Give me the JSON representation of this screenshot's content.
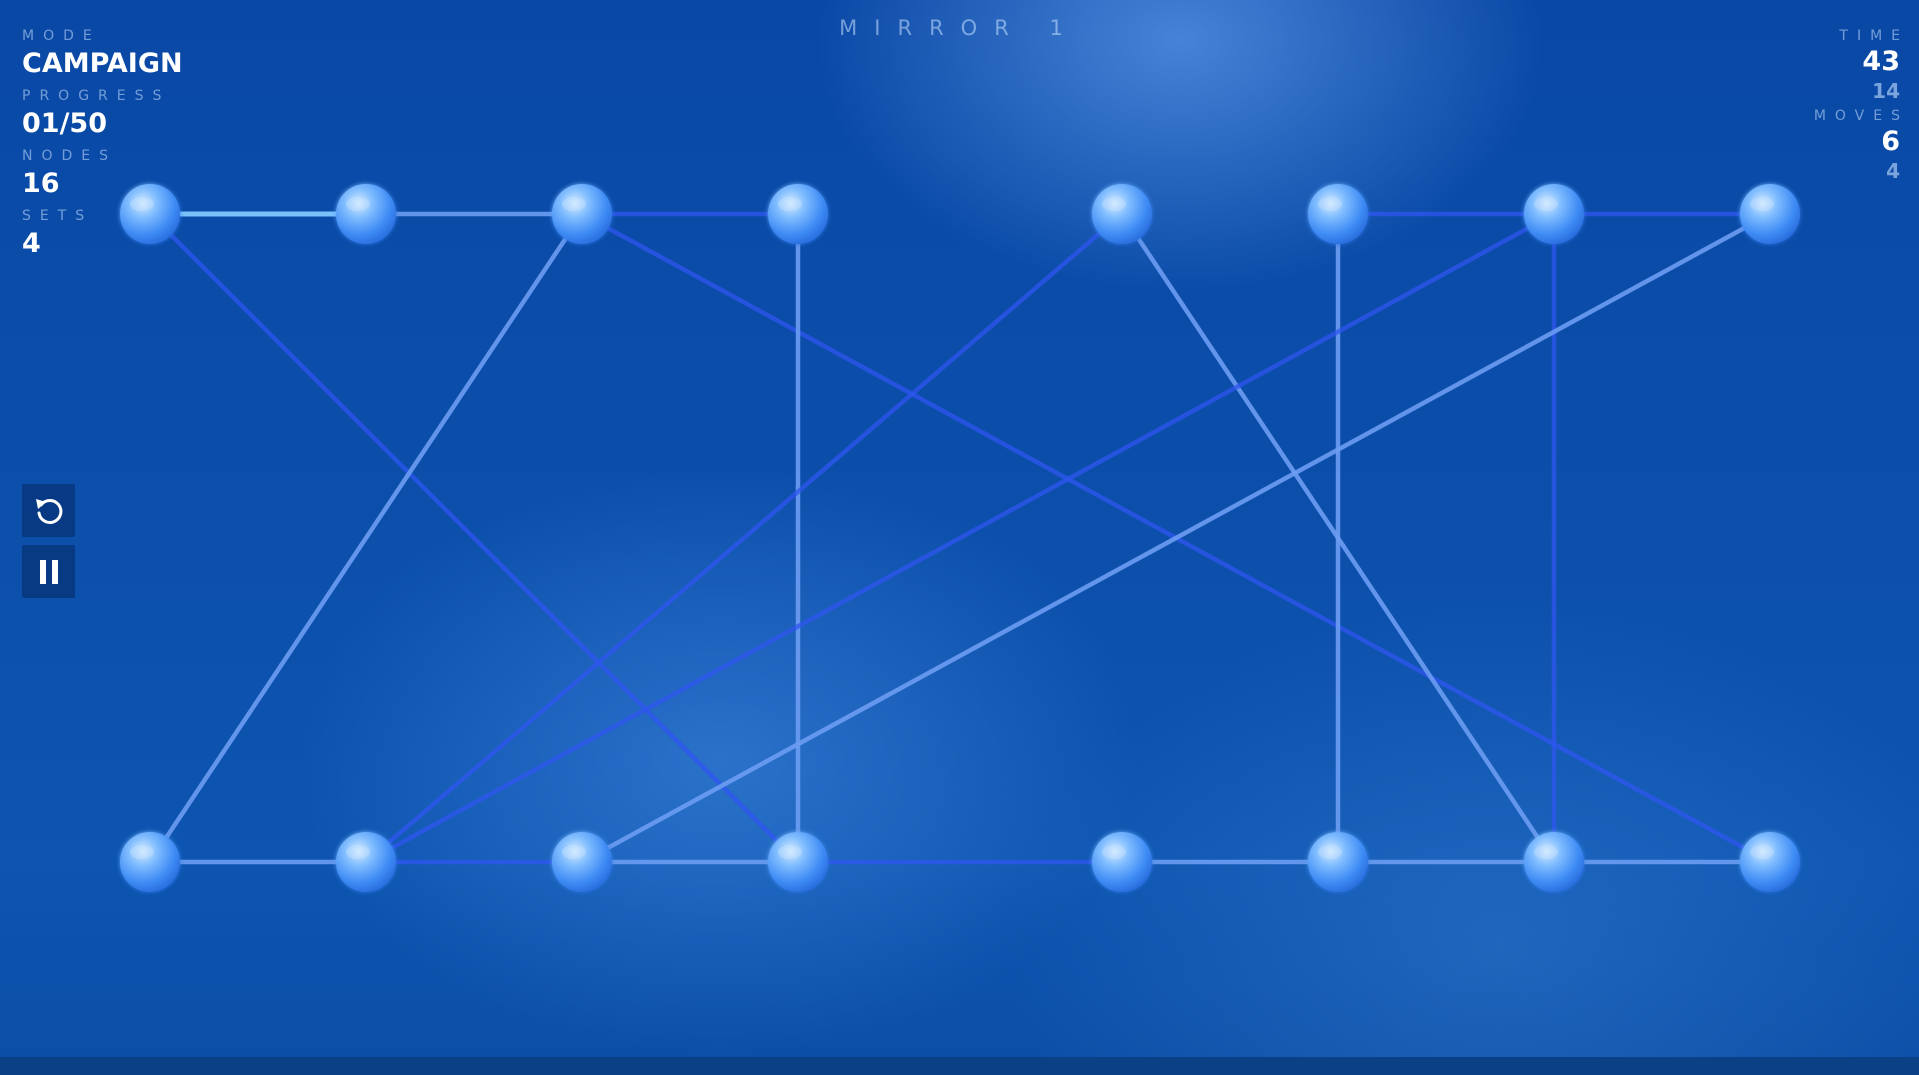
{
  "title": "MIRROR 1",
  "hud_left": {
    "mode_label": "MODE",
    "mode_value": "CAMPAIGN",
    "progress_label": "PROGRESS",
    "progress_value": "01/50",
    "nodes_label": "NODES",
    "nodes_value": "16",
    "sets_label": "SETS",
    "sets_value": "4"
  },
  "hud_right": {
    "time_label": "TIME",
    "time_value": "43",
    "time_sub": "14",
    "moves_label": "MOVES",
    "moves_value": "6",
    "moves_sub": "4"
  },
  "controls": {
    "restart_icon": "restart-icon",
    "pause_icon": "pause-icon"
  },
  "colors": {
    "background": "#0b4eaa",
    "node": "#5aa8ff",
    "node_highlight": "#cfe6ff",
    "edge": "#6b9cf2",
    "edge_strong": "#2f55f0",
    "edge_bright": "#7fc8ff"
  },
  "graph": {
    "nodes": [
      {
        "id": "t1",
        "col": 0,
        "row": 0
      },
      {
        "id": "t2",
        "col": 1,
        "row": 0
      },
      {
        "id": "t3",
        "col": 2,
        "row": 0
      },
      {
        "id": "t4",
        "col": 3,
        "row": 0
      },
      {
        "id": "t5",
        "col": 4,
        "row": 0
      },
      {
        "id": "t6",
        "col": 5,
        "row": 0
      },
      {
        "id": "t7",
        "col": 6,
        "row": 0
      },
      {
        "id": "t8",
        "col": 7,
        "row": 0
      },
      {
        "id": "b1",
        "col": 0,
        "row": 1
      },
      {
        "id": "b2",
        "col": 1,
        "row": 1
      },
      {
        "id": "b3",
        "col": 2,
        "row": 1
      },
      {
        "id": "b4",
        "col": 3,
        "row": 1
      },
      {
        "id": "b5",
        "col": 4,
        "row": 1
      },
      {
        "id": "b6",
        "col": 5,
        "row": 1
      },
      {
        "id": "b7",
        "col": 6,
        "row": 1
      },
      {
        "id": "b8",
        "col": 7,
        "row": 1
      }
    ],
    "edges": [
      {
        "from": "t1",
        "to": "t2",
        "style": "bright"
      },
      {
        "from": "t2",
        "to": "t3",
        "style": "normal"
      },
      {
        "from": "t3",
        "to": "t4",
        "style": "strong"
      },
      {
        "from": "t6",
        "to": "t7",
        "style": "strong"
      },
      {
        "from": "t7",
        "to": "t8",
        "style": "strong"
      },
      {
        "from": "b1",
        "to": "b2",
        "style": "normal"
      },
      {
        "from": "b2",
        "to": "b3",
        "style": "strong"
      },
      {
        "from": "b3",
        "to": "b4",
        "style": "normal"
      },
      {
        "from": "b4",
        "to": "b5",
        "style": "strong"
      },
      {
        "from": "b5",
        "to": "b6",
        "style": "normal"
      },
      {
        "from": "b6",
        "to": "b7",
        "style": "normal"
      },
      {
        "from": "b7",
        "to": "b8",
        "style": "normal"
      },
      {
        "from": "t1",
        "to": "b4",
        "style": "strong"
      },
      {
        "from": "t3",
        "to": "b1",
        "style": "normal"
      },
      {
        "from": "t3",
        "to": "b8",
        "style": "strong"
      },
      {
        "from": "t4",
        "to": "b4",
        "style": "normal"
      },
      {
        "from": "t5",
        "to": "b2",
        "style": "strong"
      },
      {
        "from": "t5",
        "to": "b7",
        "style": "normal"
      },
      {
        "from": "t6",
        "to": "b6",
        "style": "normal"
      },
      {
        "from": "t7",
        "to": "b2",
        "style": "strong"
      },
      {
        "from": "t7",
        "to": "b7",
        "style": "strong"
      },
      {
        "from": "t8",
        "to": "b3",
        "style": "normal"
      }
    ]
  }
}
